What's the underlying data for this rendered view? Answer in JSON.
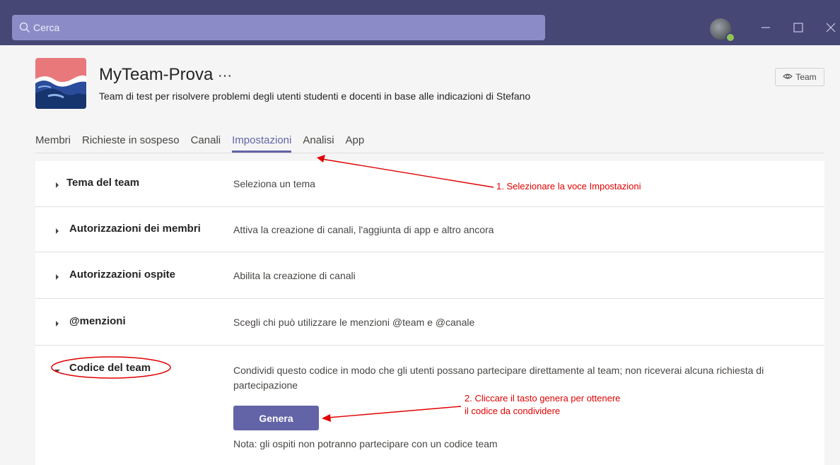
{
  "search": {
    "placeholder": "Cerca"
  },
  "header": {
    "team_name": "MyTeam-Prova",
    "more": "···",
    "description": "Team di test per risolvere problemi degli utenti studenti e docenti in base alle indicazioni di Stefano",
    "team_button_label": "Team"
  },
  "tabs": [
    {
      "label": "Membri"
    },
    {
      "label": "Richieste in sospeso"
    },
    {
      "label": "Canali"
    },
    {
      "label": "Impostazioni",
      "active": true
    },
    {
      "label": "Analisi"
    },
    {
      "label": "App"
    }
  ],
  "settings": [
    {
      "title": "Tema del team",
      "description": "Seleziona un tema"
    },
    {
      "title": "Autorizzazioni dei membri",
      "description": "Attiva la creazione di canali, l'aggiunta di app e altro ancora"
    },
    {
      "title": "Autorizzazioni ospite",
      "description": "Abilita la creazione di canali"
    },
    {
      "title": "@menzioni",
      "description": "Scegli chi può utilizzare le menzioni @team e @canale"
    },
    {
      "title": "Codice del team",
      "description": "Condividi questo codice in modo che gli utenti possano partecipare direttamente al team; non riceverai alcuna richiesta di partecipazione"
    }
  ],
  "code_section": {
    "generate_label": "Genera",
    "note": "Nota: gli ospiti non potranno partecipare con un codice team"
  },
  "annotations": {
    "step1": "1. Selezionare la voce Impostazioni",
    "step2_line1": "2. Cliccare il tasto genera per ottenere",
    "step2_line2": "il codice da condividere"
  },
  "colors": {
    "titlebar": "#464775",
    "accent": "#6264a7",
    "annotation": "#e00000",
    "presence": "#92c353"
  }
}
